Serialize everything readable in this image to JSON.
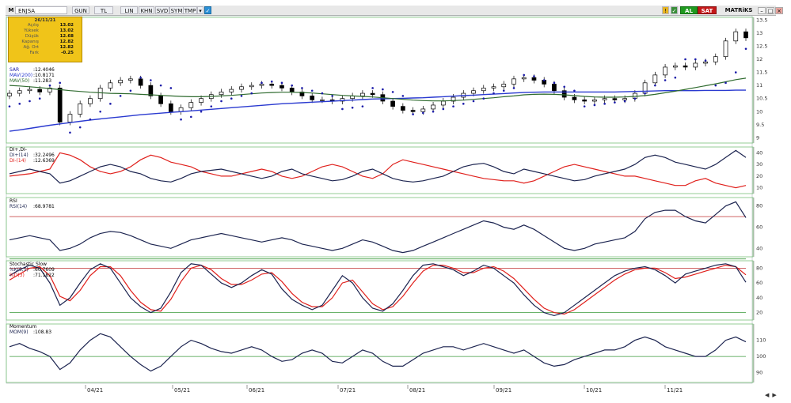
{
  "toolbar": {
    "symbol": "ENJSA",
    "buttons": [
      "GUN",
      "TL",
      "LIN",
      "KHN",
      "SVD",
      "SYM",
      "TMP"
    ],
    "buy_label": "AL",
    "sell_label": "SAT",
    "matrix_label": "MATRiKS"
  },
  "infobox": {
    "date": "26/11/21",
    "rows": [
      {
        "label": "Açılış",
        "value": "13.02"
      },
      {
        "label": "Yüksek",
        "value": "13.02"
      },
      {
        "label": "Düşük",
        "value": "12.68"
      },
      {
        "label": "Kapanış",
        "value": "12.82"
      },
      {
        "label": "Ağ. Ort",
        "value": "12.82"
      },
      {
        "label": "Fark",
        "value": "-0.25"
      }
    ]
  },
  "colors": {
    "price": "#000000",
    "sar": "#1a1aa8",
    "mav200": "#2a3ad0",
    "mav50": "#2f6b2f",
    "di_plus": "#1c2450",
    "di_minus": "#e0201c",
    "rsi": "#1c2450",
    "k": "#1c2450",
    "d": "#e0201c",
    "mom": "#1c2450",
    "ref_red": "#c03030",
    "ref_green": "#3a9a3a",
    "grid": "#7ac07a",
    "panel_bg": "#f2f2e8"
  },
  "chart_data": [
    {
      "type": "candlestick",
      "title": "",
      "legend": [
        {
          "label": "SAR",
          "value": ":12.4046"
        },
        {
          "label": "MAV(200)",
          "value": ":10.8171"
        },
        {
          "label": "MAV(50)",
          "value": ":11.283"
        }
      ],
      "ylim": [
        8.8,
        13.6
      ],
      "yticks": [
        "13.5",
        "13",
        "12.5",
        "12",
        "11.5",
        "11",
        "10.5",
        "10",
        "9.5",
        "9"
      ],
      "x_ticks": [
        "04/21",
        "05/21",
        "06/21",
        "07/21",
        "08/21",
        "09/21",
        "10/21",
        "11/21"
      ],
      "series": [
        {
          "name": "Close",
          "values": [
            10.7,
            10.8,
            10.85,
            10.75,
            10.9,
            9.6,
            9.9,
            10.3,
            10.5,
            10.9,
            11.1,
            11.2,
            11.25,
            11.0,
            10.6,
            10.3,
            10.0,
            10.15,
            10.35,
            10.5,
            10.65,
            10.75,
            10.85,
            10.95,
            11.0,
            11.05,
            11.0,
            10.9,
            10.75,
            10.6,
            10.45,
            10.45,
            10.4,
            10.5,
            10.6,
            10.7,
            10.65,
            10.4,
            10.2,
            10.05,
            10.0,
            10.1,
            10.25,
            10.4,
            10.55,
            10.7,
            10.8,
            10.9,
            10.95,
            11.05,
            11.25,
            11.3,
            11.2,
            11.05,
            10.8,
            10.55,
            10.45,
            10.4,
            10.45,
            10.5,
            10.45,
            10.5,
            10.7,
            11.1,
            11.4,
            11.7,
            11.75,
            11.7,
            11.85,
            11.9,
            12.1,
            12.7,
            13.05,
            12.82
          ]
        },
        {
          "name": "SAR",
          "values": [
            10.2,
            10.3,
            10.4,
            10.5,
            11.0,
            11.1,
            9.2,
            9.4,
            9.7,
            10.0,
            10.3,
            10.6,
            10.8,
            11.3,
            11.2,
            11.0,
            10.9,
            9.7,
            9.8,
            10.0,
            10.2,
            10.4,
            10.5,
            10.6,
            10.7,
            11.1,
            11.15,
            11.1,
            11.0,
            10.9,
            10.8,
            10.7,
            10.6,
            10.1,
            10.15,
            10.2,
            10.9,
            10.85,
            10.75,
            10.6,
            9.9,
            9.95,
            10.0,
            10.1,
            10.2,
            10.3,
            10.4,
            10.5,
            10.7,
            10.8,
            10.9,
            11.4,
            11.35,
            11.2,
            11.1,
            10.95,
            10.8,
            10.2,
            10.25,
            10.3,
            10.35,
            10.4,
            10.5,
            10.7,
            11.0,
            11.2,
            11.3,
            12.0,
            12.0,
            11.95,
            11.0,
            11.1,
            11.5,
            12.4
          ]
        },
        {
          "name": "MAV(200)",
          "values": [
            9.25,
            9.3,
            9.36,
            9.42,
            9.48,
            9.53,
            9.58,
            9.63,
            9.68,
            9.72,
            9.76,
            9.8,
            9.84,
            9.88,
            9.91,
            9.94,
            9.97,
            10.0,
            10.03,
            10.06,
            10.09,
            10.12,
            10.15,
            10.18,
            10.21,
            10.24,
            10.27,
            10.3,
            10.32,
            10.34,
            10.36,
            10.38,
            10.4,
            10.42,
            10.44,
            10.46,
            10.48,
            10.49,
            10.5,
            10.51,
            10.52,
            10.53,
            10.55,
            10.57,
            10.59,
            10.61,
            10.63,
            10.65,
            10.67,
            10.69,
            10.71,
            10.73,
            10.74,
            10.75,
            10.75,
            10.75,
            10.75,
            10.75,
            10.75,
            10.75,
            10.75,
            10.76,
            10.77,
            10.78,
            10.79,
            10.8,
            10.8,
            10.8,
            10.8,
            10.81,
            10.81,
            10.81,
            10.82,
            10.82
          ]
        },
        {
          "name": "MAV(50)",
          "values": [
            11.0,
            10.98,
            10.95,
            10.92,
            10.88,
            10.84,
            10.8,
            10.77,
            10.74,
            10.72,
            10.7,
            10.69,
            10.68,
            10.66,
            10.64,
            10.62,
            10.6,
            10.58,
            10.57,
            10.57,
            10.58,
            10.6,
            10.62,
            10.65,
            10.68,
            10.71,
            10.73,
            10.74,
            10.74,
            10.73,
            10.71,
            10.68,
            10.65,
            10.62,
            10.6,
            10.58,
            10.56,
            10.53,
            10.5,
            10.47,
            10.44,
            10.42,
            10.41,
            10.41,
            10.42,
            10.44,
            10.47,
            10.5,
            10.53,
            10.57,
            10.6,
            10.64,
            10.66,
            10.67,
            10.66,
            10.64,
            10.61,
            10.58,
            10.56,
            10.55,
            10.55,
            10.56,
            10.58,
            10.61,
            10.66,
            10.72,
            10.78,
            10.85,
            10.92,
            10.99,
            11.06,
            11.14,
            11.22,
            11.28
          ]
        }
      ]
    },
    {
      "type": "line",
      "title": "DI+,DI-",
      "legend": [
        {
          "label": "DI+(14)",
          "value": ":32.2496"
        },
        {
          "label": "DI-(14)",
          "value": ":12.6369"
        }
      ],
      "ylim": [
        5,
        45
      ],
      "yticks": [
        "40",
        "30",
        "20",
        "10"
      ],
      "series": [
        {
          "name": "DI+(14)",
          "values": [
            22,
            24,
            26,
            24,
            22,
            14,
            16,
            20,
            24,
            28,
            30,
            28,
            24,
            22,
            18,
            16,
            15,
            18,
            22,
            24,
            25,
            26,
            24,
            22,
            20,
            18,
            20,
            24,
            26,
            22,
            20,
            18,
            16,
            17,
            20,
            24,
            26,
            22,
            18,
            16,
            15,
            16,
            18,
            20,
            24,
            28,
            30,
            31,
            28,
            24,
            22,
            26,
            24,
            22,
            20,
            18,
            16,
            17,
            20,
            22,
            24,
            26,
            30,
            36,
            38,
            36,
            32,
            30,
            28,
            26,
            30,
            36,
            42,
            36
          ]
        },
        {
          "name": "DI-(14)",
          "values": [
            20,
            21,
            22,
            24,
            26,
            40,
            38,
            34,
            28,
            24,
            22,
            24,
            28,
            34,
            38,
            36,
            32,
            30,
            28,
            24,
            22,
            20,
            20,
            22,
            24,
            26,
            24,
            20,
            18,
            20,
            24,
            28,
            30,
            28,
            24,
            20,
            18,
            22,
            30,
            34,
            32,
            30,
            28,
            26,
            24,
            22,
            20,
            18,
            17,
            16,
            16,
            14,
            16,
            20,
            24,
            28,
            30,
            28,
            26,
            24,
            22,
            20,
            20,
            18,
            16,
            14,
            12,
            12,
            16,
            18,
            14,
            12,
            10,
            12
          ]
        }
      ]
    },
    {
      "type": "line",
      "title": "RSI",
      "legend": [
        {
          "label": "RSI(14)",
          "value": ":68.9781"
        }
      ],
      "ylim": [
        32,
        88
      ],
      "yticks": [
        "80",
        "60",
        "40"
      ],
      "series": [
        {
          "name": "RSI(14)",
          "values": [
            48,
            50,
            52,
            50,
            48,
            38,
            40,
            44,
            50,
            54,
            56,
            55,
            52,
            48,
            44,
            42,
            40,
            44,
            48,
            50,
            52,
            54,
            52,
            50,
            48,
            46,
            48,
            50,
            48,
            44,
            42,
            40,
            38,
            40,
            44,
            48,
            46,
            42,
            38,
            36,
            38,
            42,
            46,
            50,
            54,
            58,
            62,
            66,
            64,
            60,
            58,
            62,
            58,
            52,
            46,
            40,
            38,
            40,
            44,
            46,
            48,
            50,
            56,
            68,
            74,
            76,
            76,
            70,
            66,
            64,
            72,
            80,
            84,
            69
          ]
        }
      ]
    },
    {
      "type": "line",
      "title": "Stochastic Slow",
      "legend": [
        {
          "label": "%K(5,5)",
          "value": ":60.7609"
        },
        {
          "label": "%D(3)",
          "value": ":71.1822"
        }
      ],
      "ylim": [
        10,
        90
      ],
      "yticks": [
        "80",
        "60",
        "40",
        "20"
      ],
      "series": [
        {
          "name": "%K(5,5)",
          "values": [
            70,
            78,
            84,
            80,
            60,
            30,
            40,
            60,
            78,
            86,
            80,
            60,
            40,
            28,
            20,
            26,
            48,
            74,
            86,
            84,
            72,
            60,
            54,
            60,
            70,
            78,
            72,
            52,
            38,
            30,
            24,
            30,
            50,
            70,
            60,
            40,
            26,
            22,
            32,
            50,
            70,
            84,
            86,
            82,
            78,
            70,
            76,
            84,
            80,
            70,
            60,
            44,
            30,
            20,
            16,
            20,
            30,
            40,
            50,
            60,
            70,
            76,
            80,
            82,
            78,
            70,
            60,
            72,
            76,
            80,
            84,
            86,
            82,
            61
          ]
        },
        {
          "name": "%D(3)",
          "values": [
            64,
            72,
            80,
            82,
            70,
            42,
            36,
            50,
            70,
            82,
            82,
            70,
            50,
            34,
            24,
            22,
            38,
            62,
            80,
            84,
            78,
            66,
            58,
            58,
            64,
            72,
            74,
            62,
            46,
            34,
            28,
            28,
            40,
            60,
            64,
            48,
            32,
            24,
            28,
            42,
            60,
            76,
            84,
            84,
            80,
            74,
            74,
            80,
            82,
            76,
            66,
            52,
            38,
            26,
            20,
            18,
            24,
            34,
            44,
            54,
            64,
            72,
            78,
            80,
            80,
            74,
            66,
            68,
            72,
            76,
            80,
            84,
            82,
            71
          ]
        }
      ]
    },
    {
      "type": "line",
      "title": "Momentum",
      "legend": [
        {
          "label": "MOM(9)",
          "value": ":108.83"
        }
      ],
      "ylim": [
        84,
        120
      ],
      "yticks": [
        "110",
        "100",
        "90"
      ],
      "series": [
        {
          "name": "MOM(9)",
          "values": [
            106,
            108,
            105,
            103,
            100,
            92,
            96,
            104,
            110,
            114,
            112,
            106,
            100,
            95,
            91,
            94,
            100,
            106,
            110,
            108,
            105,
            103,
            102,
            104,
            106,
            104,
            100,
            97,
            98,
            102,
            104,
            102,
            97,
            96,
            100,
            104,
            102,
            97,
            94,
            94,
            98,
            102,
            104,
            106,
            106,
            104,
            106,
            108,
            106,
            104,
            102,
            104,
            100,
            96,
            94,
            95,
            98,
            100,
            102,
            104,
            104,
            106,
            110,
            112,
            110,
            106,
            104,
            102,
            100,
            100,
            104,
            110,
            112,
            109
          ]
        }
      ]
    }
  ]
}
